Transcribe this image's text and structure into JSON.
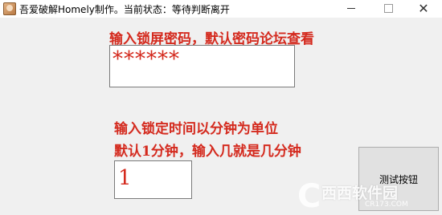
{
  "window": {
    "title": "吾爱破解Homely制作。当前状态：等待判断离开",
    "app_icon": "app-icon",
    "min_icon": "minimize-icon",
    "max_icon": "maximize-icon",
    "close_icon": "close-icon",
    "close_glyph": "✕"
  },
  "form": {
    "password_label": "输入锁屏密码，默认密码论坛查看",
    "password_value": "******",
    "time_label_line1": "输入锁定时间以分钟为单位",
    "time_label_line2": "默认1分钟，输入几就是几分钟",
    "time_value": "1",
    "test_button_label": "测试按钮"
  },
  "watermark": {
    "logo_letter": "C",
    "text": "西西软件园",
    "sub": "CR173.COM"
  },
  "colors": {
    "label_red": "#d42a1e",
    "client_bg": "#f0f0f0"
  }
}
